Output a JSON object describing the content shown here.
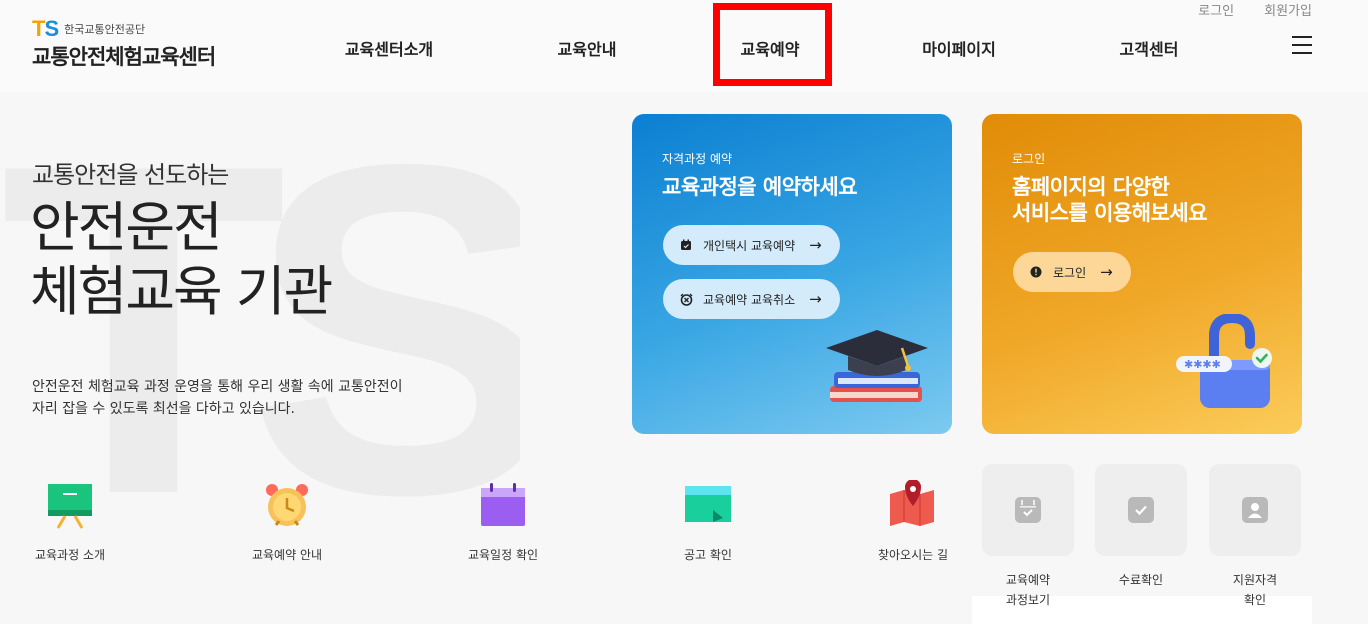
{
  "header": {
    "org_name": "한국교통안전공단",
    "site_name": "교통안전체험교육센터",
    "login": "로그인",
    "signup": "회원가입"
  },
  "nav": [
    {
      "label": "교육센터소개"
    },
    {
      "label": "교육안내"
    },
    {
      "label": "교육예약",
      "highlighted": true
    },
    {
      "label": "마이페이지"
    },
    {
      "label": "고객센터"
    }
  ],
  "hero": {
    "watermark": "TS",
    "subtitle": "교통안전을 선도하는",
    "title_line1": "안전운전",
    "title_line2": "체험교육 기관",
    "desc_line1": "안전운전 체험교육 과정 운영을 통해 우리 생활 속에 교통안전이",
    "desc_line2": "자리 잡을 수 있도록 최선을 다하고 있습니다."
  },
  "cards": {
    "reserve": {
      "label": "자격과정 예약",
      "title": "교육과정을 예약하세요",
      "button1": "개인택시 교육예약",
      "button2": "교육예약 교육취소",
      "icon1": "calendar-icon",
      "icon2": "alarm-clock-icon",
      "illustration": "graduation-cap-books-icon"
    },
    "login": {
      "label": "로그인",
      "title": "홈페이지의 다양한\n서비스를 이용해보세요",
      "button": "로그인",
      "icon": "alert-circle-icon",
      "illustration": "unlocked-padlock-icon"
    }
  },
  "quick_links": [
    {
      "label": "교육과정 소개",
      "icon": "presentation-board-icon"
    },
    {
      "label": "교육예약 안내",
      "icon": "alarm-clock-icon"
    },
    {
      "label": "교육일정 확인",
      "icon": "calendar-icon"
    },
    {
      "label": "공고 확인",
      "icon": "notice-board-icon"
    },
    {
      "label": "찾아오시는 길",
      "icon": "map-pin-icon"
    }
  ],
  "tiles": [
    {
      "label": "교육예약\n과정보기",
      "icon": "calendar-icon"
    },
    {
      "label": "수료확인",
      "icon": "check-icon"
    },
    {
      "label": "지원자격\n확인",
      "icon": "user-icon"
    }
  ],
  "colors": {
    "highlight": "#ff0000",
    "card_blue": "#1a8fd6",
    "card_orange": "#ed9d1e",
    "brand_orange": "#f4a300",
    "brand_blue": "#1a8fd6"
  }
}
